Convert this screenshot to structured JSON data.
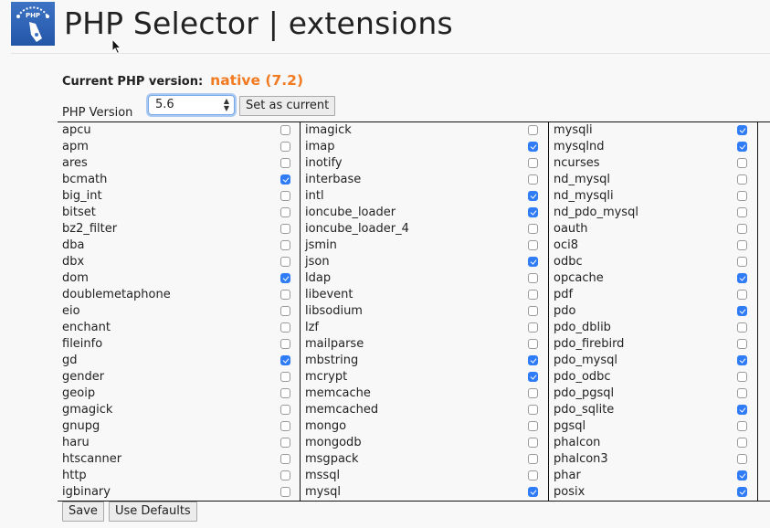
{
  "header": {
    "logo_icon": "php-selector-gauge-icon",
    "logo_text": "PHP",
    "title": "PHP Selector | extensions"
  },
  "current_version": {
    "label": "Current PHP version:",
    "value": "native (7.2)",
    "value_color": "#f27a21"
  },
  "version_picker": {
    "label": "PHP Version",
    "selected": "5.6",
    "set_button": "Set as current"
  },
  "extensions": {
    "columns": [
      [
        {
          "name": "apcu",
          "enabled": false
        },
        {
          "name": "apm",
          "enabled": false
        },
        {
          "name": "ares",
          "enabled": false
        },
        {
          "name": "bcmath",
          "enabled": true
        },
        {
          "name": "big_int",
          "enabled": false
        },
        {
          "name": "bitset",
          "enabled": false
        },
        {
          "name": "bz2_filter",
          "enabled": false
        },
        {
          "name": "dba",
          "enabled": false
        },
        {
          "name": "dbx",
          "enabled": false
        },
        {
          "name": "dom",
          "enabled": true
        },
        {
          "name": "doublemetaphone",
          "enabled": false
        },
        {
          "name": "eio",
          "enabled": false
        },
        {
          "name": "enchant",
          "enabled": false
        },
        {
          "name": "fileinfo",
          "enabled": false
        },
        {
          "name": "gd",
          "enabled": true
        },
        {
          "name": "gender",
          "enabled": false
        },
        {
          "name": "geoip",
          "enabled": false
        },
        {
          "name": "gmagick",
          "enabled": false
        },
        {
          "name": "gnupg",
          "enabled": false
        },
        {
          "name": "haru",
          "enabled": false
        },
        {
          "name": "htscanner",
          "enabled": false
        },
        {
          "name": "http",
          "enabled": false
        },
        {
          "name": "igbinary",
          "enabled": false
        }
      ],
      [
        {
          "name": "imagick",
          "enabled": false
        },
        {
          "name": "imap",
          "enabled": true
        },
        {
          "name": "inotify",
          "enabled": false
        },
        {
          "name": "interbase",
          "enabled": false
        },
        {
          "name": "intl",
          "enabled": true
        },
        {
          "name": "ioncube_loader",
          "enabled": true
        },
        {
          "name": "ioncube_loader_4",
          "enabled": false
        },
        {
          "name": "jsmin",
          "enabled": false
        },
        {
          "name": "json",
          "enabled": true
        },
        {
          "name": "ldap",
          "enabled": false
        },
        {
          "name": "libevent",
          "enabled": false
        },
        {
          "name": "libsodium",
          "enabled": false
        },
        {
          "name": "lzf",
          "enabled": false
        },
        {
          "name": "mailparse",
          "enabled": false
        },
        {
          "name": "mbstring",
          "enabled": true
        },
        {
          "name": "mcrypt",
          "enabled": true
        },
        {
          "name": "memcache",
          "enabled": false
        },
        {
          "name": "memcached",
          "enabled": false
        },
        {
          "name": "mongo",
          "enabled": false
        },
        {
          "name": "mongodb",
          "enabled": false
        },
        {
          "name": "msgpack",
          "enabled": false
        },
        {
          "name": "mssql",
          "enabled": false
        },
        {
          "name": "mysql",
          "enabled": true
        }
      ],
      [
        {
          "name": "mysqli",
          "enabled": true
        },
        {
          "name": "mysqlnd",
          "enabled": true
        },
        {
          "name": "ncurses",
          "enabled": false
        },
        {
          "name": "nd_mysql",
          "enabled": false
        },
        {
          "name": "nd_mysqli",
          "enabled": false
        },
        {
          "name": "nd_pdo_mysql",
          "enabled": false
        },
        {
          "name": "oauth",
          "enabled": false
        },
        {
          "name": "oci8",
          "enabled": false
        },
        {
          "name": "odbc",
          "enabled": false
        },
        {
          "name": "opcache",
          "enabled": true
        },
        {
          "name": "pdf",
          "enabled": false
        },
        {
          "name": "pdo",
          "enabled": true
        },
        {
          "name": "pdo_dblib",
          "enabled": false
        },
        {
          "name": "pdo_firebird",
          "enabled": false
        },
        {
          "name": "pdo_mysql",
          "enabled": true
        },
        {
          "name": "pdo_odbc",
          "enabled": false
        },
        {
          "name": "pdo_pgsql",
          "enabled": false
        },
        {
          "name": "pdo_sqlite",
          "enabled": true
        },
        {
          "name": "pgsql",
          "enabled": false
        },
        {
          "name": "phalcon",
          "enabled": false
        },
        {
          "name": "phalcon3",
          "enabled": false
        },
        {
          "name": "phar",
          "enabled": true
        },
        {
          "name": "posix",
          "enabled": true
        }
      ]
    ]
  },
  "footer": {
    "save_label": "Save",
    "defaults_label": "Use Defaults"
  }
}
